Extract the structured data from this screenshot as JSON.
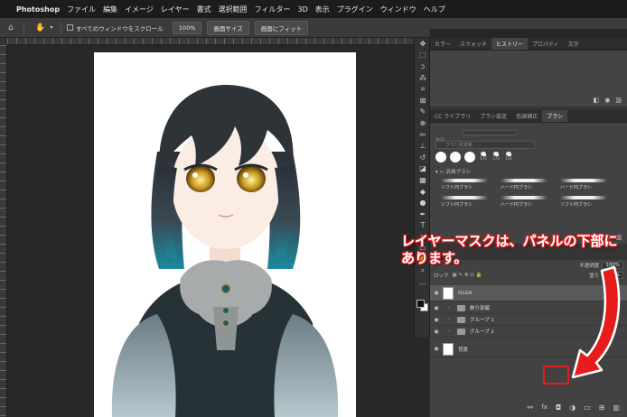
{
  "menubar": {
    "app_name": "Photoshop",
    "items": [
      "ファイル",
      "編集",
      "イメージ",
      "レイヤー",
      "書式",
      "選択範囲",
      "フィルター",
      "3D",
      "表示",
      "プラグイン",
      "ウィンドウ",
      "ヘルプ"
    ]
  },
  "options_bar": {
    "scroll_all_label": "すべてのウィンドウをスクロール",
    "zoom_button": "100%",
    "fit_screen_button": "画面サイズ",
    "fill_screen_button": "画面にフィット"
  },
  "history_panel": {
    "tabs": [
      "カラー",
      "スウォッチ",
      "ヒストリー",
      "プロパティ",
      "文字"
    ],
    "active_tab": "ヒストリー"
  },
  "brush_panel": {
    "tabs": [
      "CC ライブラリ",
      "ブラシ設定",
      "色調補正",
      "ブラシ"
    ],
    "active_tab": "ブラシ",
    "size_label": "直径",
    "search_placeholder": "ブラシを検索",
    "preset_sizes": [
      "175",
      "175",
      "150"
    ],
    "folder_label": "汎用ブラシ",
    "brushes": [
      "ソフト円ブラシ",
      "ハード円ブラシ",
      "ハード円ブラシ",
      "ソフト円ブラシ",
      "ハード円ブラシ",
      "ソフト円ブラシ"
    ]
  },
  "layers_panel": {
    "opacity_label": "不透明度",
    "opacity_value": "100%",
    "lock_label": "ロック",
    "fill_label": "塗り",
    "fill_value": "100%",
    "layers": [
      {
        "name": "OLGA",
        "kind": "layer",
        "selected": true
      },
      {
        "name": "飾り部編",
        "kind": "group",
        "selected": false
      },
      {
        "name": "グループ 1",
        "kind": "group",
        "selected": false
      },
      {
        "name": "グループ 2",
        "kind": "group",
        "selected": false
      },
      {
        "name": "背景",
        "kind": "layer",
        "selected": false
      }
    ]
  },
  "annotation": {
    "line1": "レイヤーマスクは、パネルの下部に",
    "line2": "あります。",
    "color": "#e61c1c"
  }
}
